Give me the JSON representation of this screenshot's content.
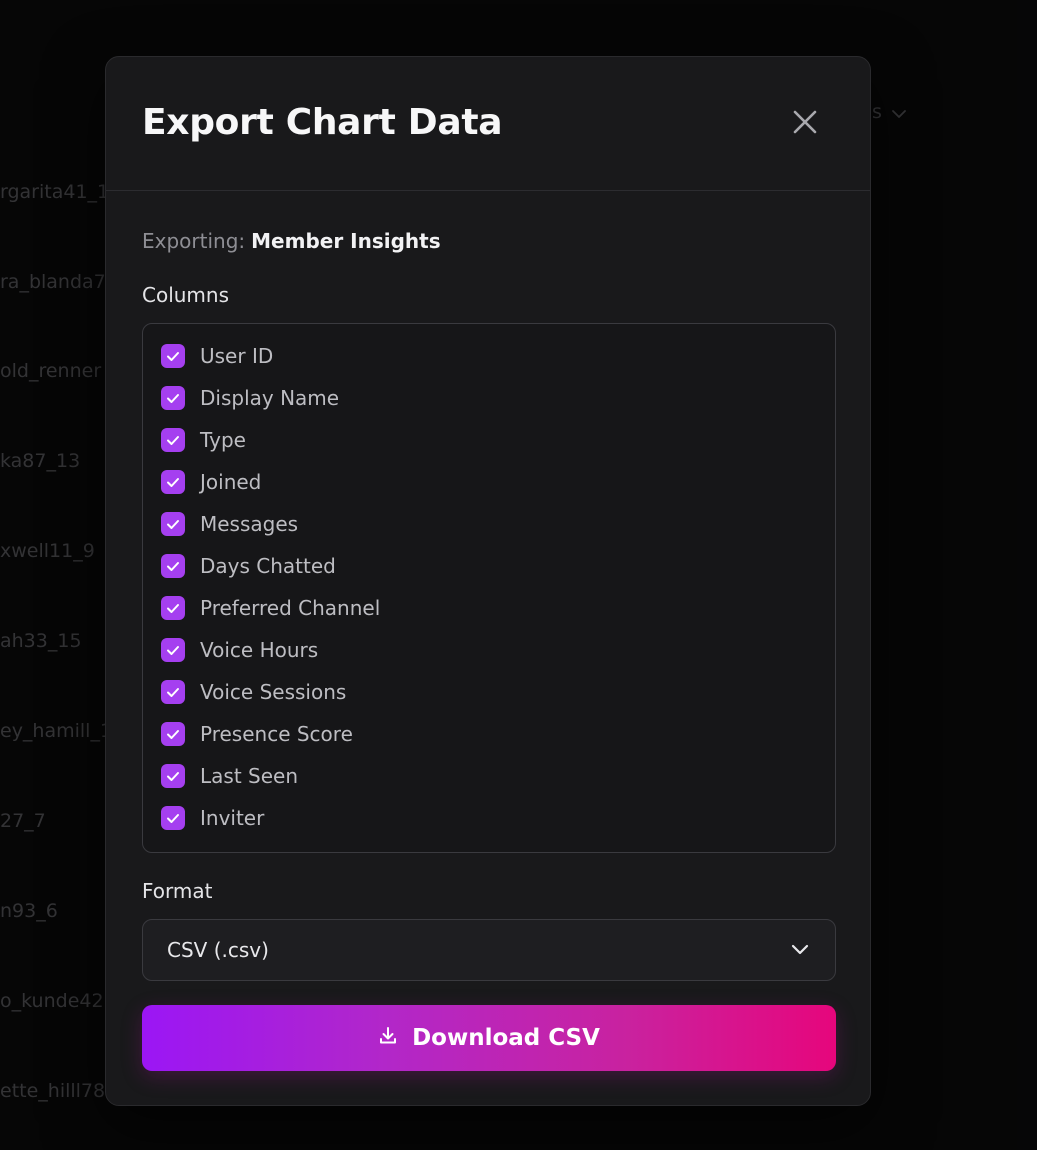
{
  "background": {
    "names": [
      "rgarita41_1",
      "ra_blanda7",
      "old_renner",
      "ka87_13",
      "xwell11_9",
      "ah33_15",
      "ey_hamill_1",
      "27_7",
      "n93_6",
      "o_kunde42",
      "ette_hilll78"
    ],
    "dropdown_fragment": "s"
  },
  "modal": {
    "title": "Export Chart Data",
    "close_icon": "close-icon",
    "exporting_label": "Exporting:",
    "exporting_value": "Member Insights",
    "columns_label": "Columns",
    "columns": [
      {
        "label": "User ID",
        "checked": true
      },
      {
        "label": "Display Name",
        "checked": true
      },
      {
        "label": "Type",
        "checked": true
      },
      {
        "label": "Joined",
        "checked": true
      },
      {
        "label": "Messages",
        "checked": true
      },
      {
        "label": "Days Chatted",
        "checked": true
      },
      {
        "label": "Preferred Channel",
        "checked": true
      },
      {
        "label": "Voice Hours",
        "checked": true
      },
      {
        "label": "Voice Sessions",
        "checked": true
      },
      {
        "label": "Presence Score",
        "checked": true
      },
      {
        "label": "Last Seen",
        "checked": true
      },
      {
        "label": "Inviter",
        "checked": true
      }
    ],
    "format_label": "Format",
    "format_value": "CSV (.csv)",
    "download_label": "Download CSV",
    "download_icon": "download-icon"
  },
  "colors": {
    "accent_purple": "#a53ff0",
    "gradient_start": "#9b16f5",
    "gradient_end": "#e6067c",
    "modal_bg": "#19191b"
  }
}
